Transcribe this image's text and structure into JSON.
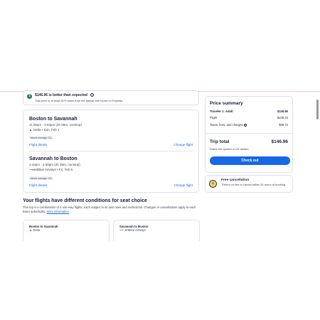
{
  "alert": {
    "icon": "dollar-down-icon",
    "title": "$146.96 is better than expected",
    "info_icon": "i",
    "subtitle": "This price is at least 51% lower than the typical fare found on Expedia"
  },
  "itinerary": {
    "segments": [
      {
        "title": "Boston to Savannah",
        "times": "11:05am - 2:04pm (2h 59m, nonstop)",
        "airline_logo": "▲",
        "airline": "Delta • Sun, Feb 1",
        "co2_badge": "Above average CO₂",
        "details_link": "Flight details",
        "change_link": "Change flight"
      },
      {
        "title": "Savannah to Boston",
        "times": "1:10pm - 3:38pm (2h 28m, nonstop)",
        "airline_logo": "⟶",
        "airline": "JetBlue Airways • Fri, Feb 6",
        "co2_badge": "Above average CO₂",
        "details_link": "Flight details",
        "change_link": "Change flight"
      }
    ]
  },
  "summary": {
    "title": "Price summary",
    "traveler_label": "Traveler 1: Adult",
    "traveler_value": "$146.96",
    "flight_label": "Flight",
    "flight_value": "$108.24",
    "taxes_label": "Taxes, fees, and charges",
    "taxes_value": "$38.72",
    "total_label": "Trip total",
    "total_value": "$146.96",
    "currency_note": "Rates are quoted in US dollars",
    "checkout_label": "Check out"
  },
  "cancellation": {
    "icon": "clock-icon",
    "title": "Free cancellation",
    "text": "There's no fee to cancel within 24 hours of booking."
  },
  "conditions": {
    "title": "Your flights have different conditions for seat choice",
    "text": "This trip is a combination of 2 one-way flights, each subject to its own rules and restrictions. Changes or cancellations apply to each ticket individually.",
    "more_link": "More information",
    "cards": [
      {
        "title": "Boston to Savannah",
        "airline_logo": "▲",
        "airline": "Delta"
      },
      {
        "title": "Savannah to Boston",
        "airline_logo": "⟶",
        "airline": "JetBlue Airways"
      }
    ]
  },
  "colors": {
    "accent": "#1668e3",
    "success": "#227950",
    "text": "#191e3b"
  }
}
